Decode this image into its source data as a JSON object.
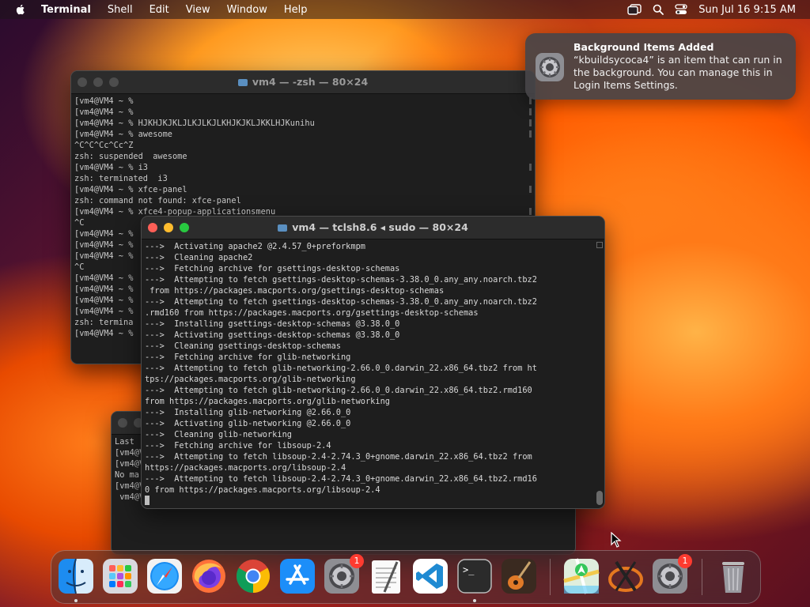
{
  "menubar": {
    "app_name": "Terminal",
    "menus": [
      "Shell",
      "Edit",
      "View",
      "Window",
      "Help"
    ],
    "datetime": "Sun Jul 16  9:15 AM"
  },
  "notification": {
    "title": "Background Items Added",
    "body": "“kbuildsycoca4” is an item that can run in the background. You can manage this in Login Items Settings.",
    "icon": "system-settings-gear-icon"
  },
  "back_window": {
    "title": "vm4 — -zsh — 80×24",
    "lines": [
      "[vm4@VM4 ~ %",
      "[vm4@VM4 ~ %",
      "[vm4@VM4 ~ % HJKHJKJKLJLKJLKJLKHJKJKLJKKLHJKunihu",
      "[vm4@VM4 ~ % awesome",
      "^C^C^Cc^Cc^Z",
      "zsh: suspended  awesome",
      "[vm4@VM4 ~ % i3",
      "zsh: terminated  i3",
      "[vm4@VM4 ~ % xfce-panel",
      "zsh: command not found: xfce-panel",
      "[vm4@VM4 ~ % xfce4-popup-applicationsmenu",
      "^C",
      "[vm4@VM4 ~ %",
      "[vm4@VM4 ~ %",
      "[vm4@VM4 ~ %",
      "^C",
      "[vm4@VM4 ~ %",
      "[vm4@VM4 ~ %",
      "[vm4@VM4 ~ %",
      "[vm4@VM4 ~ %",
      "zsh: termina",
      "[vm4@VM4 ~ %"
    ]
  },
  "third_window": {
    "lines": [
      "Last",
      "[vm4@V",
      "[vm4@V",
      "No ma",
      "[vm4@V",
      " vm4@V"
    ]
  },
  "front_window": {
    "title": "vm4 — tclsh8.6 ◂ sudo — 80×24",
    "lines": [
      "--->  Activating apache2 @2.4.57_0+preforkmpm",
      "--->  Cleaning apache2",
      "--->  Fetching archive for gsettings-desktop-schemas",
      "--->  Attempting to fetch gsettings-desktop-schemas-3.38.0_0.any_any.noarch.tbz2",
      " from https://packages.macports.org/gsettings-desktop-schemas",
      "--->  Attempting to fetch gsettings-desktop-schemas-3.38.0_0.any_any.noarch.tbz2",
      ".rmd160 from https://packages.macports.org/gsettings-desktop-schemas",
      "--->  Installing gsettings-desktop-schemas @3.38.0_0",
      "--->  Activating gsettings-desktop-schemas @3.38.0_0",
      "--->  Cleaning gsettings-desktop-schemas",
      "--->  Fetching archive for glib-networking",
      "--->  Attempting to fetch glib-networking-2.66.0_0.darwin_22.x86_64.tbz2 from ht",
      "tps://packages.macports.org/glib-networking",
      "--->  Attempting to fetch glib-networking-2.66.0_0.darwin_22.x86_64.tbz2.rmd160",
      "from https://packages.macports.org/glib-networking",
      "--->  Installing glib-networking @2.66.0_0",
      "--->  Activating glib-networking @2.66.0_0",
      "--->  Cleaning glib-networking",
      "--->  Fetching archive for libsoup-2.4",
      "--->  Attempting to fetch libsoup-2.4-2.74.3_0+gnome.darwin_22.x86_64.tbz2 from",
      "https://packages.macports.org/libsoup-2.4",
      "--->  Attempting to fetch libsoup-2.4-2.74.3_0+gnome.darwin_22.x86_64.tbz2.rmd16",
      "0 from https://packages.macports.org/libsoup-2.4"
    ]
  },
  "dock": {
    "items": [
      {
        "name": "Finder",
        "icon": "finder-icon",
        "running": true
      },
      {
        "name": "Launchpad",
        "icon": "launchpad-icon",
        "running": false
      },
      {
        "name": "Safari",
        "icon": "safari-icon",
        "running": false
      },
      {
        "name": "Firefox",
        "icon": "firefox-icon",
        "running": false
      },
      {
        "name": "Chrome",
        "icon": "chrome-icon",
        "running": false
      },
      {
        "name": "App Store",
        "icon": "app-store-icon",
        "running": false
      },
      {
        "name": "System Settings",
        "icon": "system-settings-icon",
        "badge": "1",
        "running": false
      },
      {
        "name": "TextEdit",
        "icon": "textedit-icon",
        "running": false
      },
      {
        "name": "VS Code",
        "icon": "vscode-icon",
        "running": false
      },
      {
        "name": "Terminal",
        "icon": "terminal-icon",
        "running": true
      },
      {
        "name": "GarageBand",
        "icon": "garageband-icon",
        "running": false
      },
      {
        "name": "Maps",
        "icon": "maps-icon",
        "running": false
      },
      {
        "name": "XQuartz",
        "icon": "xquartz-icon",
        "running": false
      },
      {
        "name": "System Settings",
        "icon": "system-settings-icon",
        "badge": "1",
        "running": false
      },
      {
        "name": "Trash",
        "icon": "trash-icon",
        "running": false
      }
    ]
  }
}
